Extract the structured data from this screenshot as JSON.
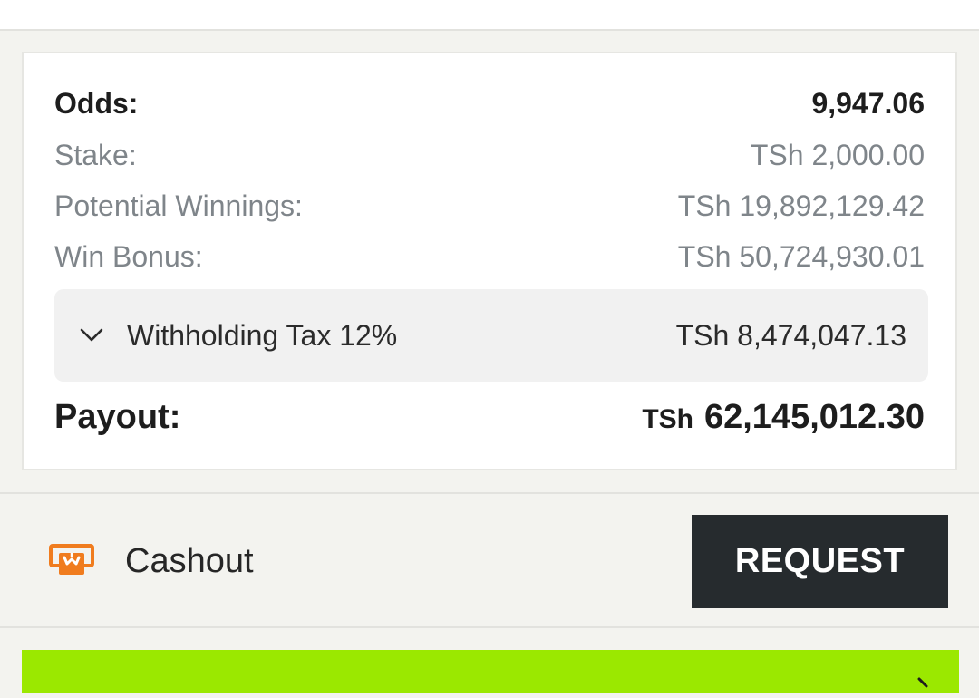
{
  "summary": {
    "odds": {
      "label": "Odds:",
      "value": "9,947.06"
    },
    "stake": {
      "label": "Stake:",
      "value": "TSh 2,000.00"
    },
    "potential_winnings": {
      "label": "Potential Winnings:",
      "value": "TSh 19,892,129.42"
    },
    "win_bonus": {
      "label": "Win Bonus:",
      "value": "TSh 50,724,930.01"
    },
    "withholding_tax": {
      "label": "Withholding Tax 12%",
      "value": "TSh 8,474,047.13",
      "icon": "chevron-down-icon"
    },
    "payout": {
      "label": "Payout:",
      "currency": "TSh",
      "amount": "62,145,012.30"
    }
  },
  "cashout": {
    "icon": "cashout-icon",
    "label": "Cashout",
    "button_label": "REQUEST"
  },
  "colors": {
    "accent_green": "#9be800",
    "button_dark": "#262b2e",
    "cashout_orange": "#f07c1e",
    "muted_text": "#7f858a"
  }
}
